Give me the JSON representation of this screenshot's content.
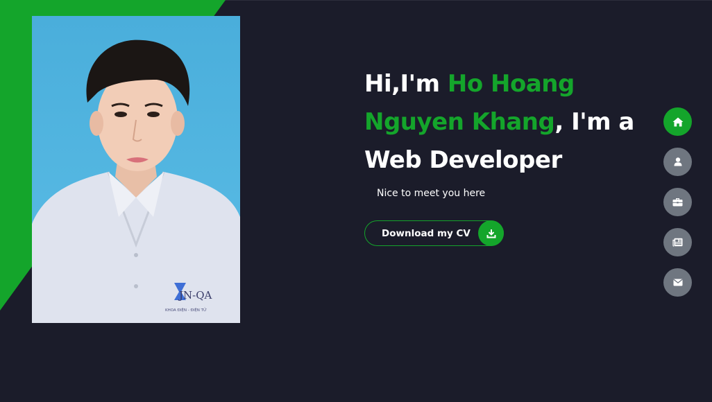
{
  "hero": {
    "greeting": "Hi,I'm ",
    "name_line1": "Ho Hoang",
    "name_line2": "Nguyen Khang",
    "role_prefix": ", I'm a",
    "role": "Web Developer",
    "tagline": "Nice to meet you here"
  },
  "cv_button": {
    "label": "Download my CV",
    "icon": "download-icon"
  },
  "portrait": {
    "badge_text": "JN-QA",
    "badge_subtext": "KHOA ĐIỆN - ĐIỆN TỬ"
  },
  "nav": {
    "items": [
      {
        "icon": "home-icon",
        "active": true
      },
      {
        "icon": "user-icon",
        "active": false
      },
      {
        "icon": "briefcase-icon",
        "active": false
      },
      {
        "icon": "newspaper-icon",
        "active": false
      },
      {
        "icon": "envelope-icon",
        "active": false
      }
    ]
  },
  "colors": {
    "background": "#1b1c2a",
    "accent": "#14a52b",
    "nav_inactive": "#6f7680",
    "text": "#ffffff"
  }
}
